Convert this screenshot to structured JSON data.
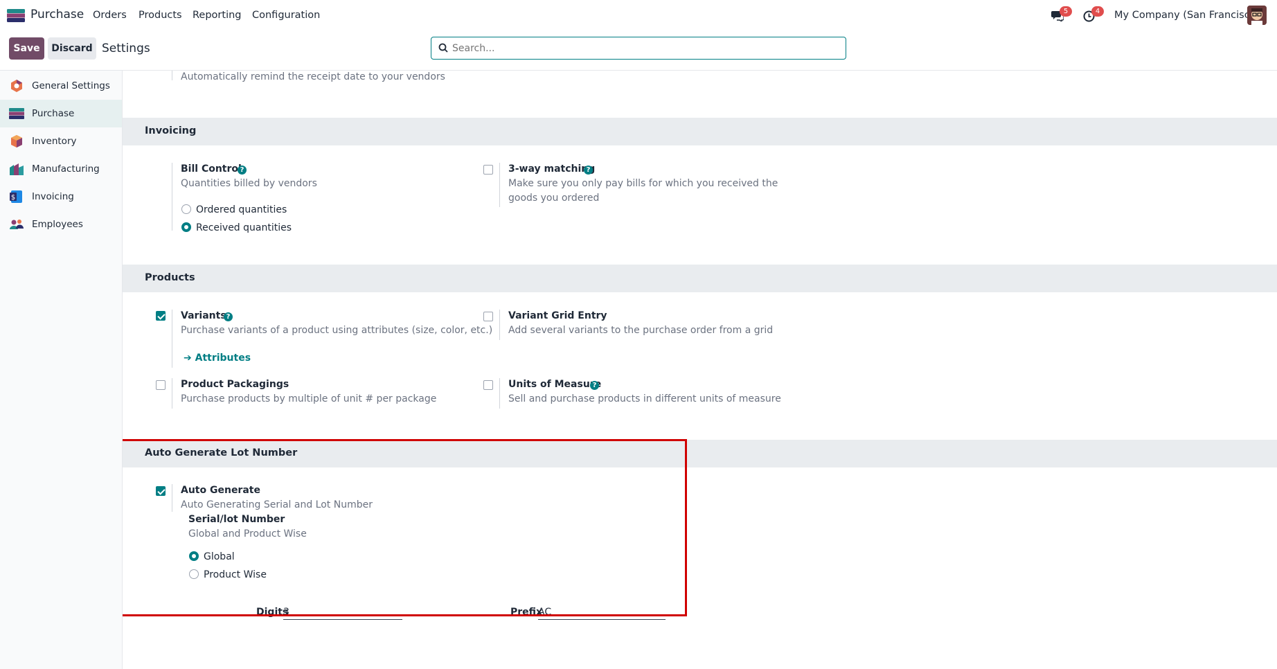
{
  "app": {
    "name": "Purchase"
  },
  "nav": {
    "menus": [
      "Orders",
      "Products",
      "Reporting",
      "Configuration"
    ],
    "messages_count": "5",
    "activities_count": "4",
    "company": "My Company (San Francisco)"
  },
  "control": {
    "save_label": "Save",
    "discard_label": "Discard",
    "breadcrumb": "Settings",
    "search_placeholder": "Search..."
  },
  "sidebar": {
    "items": [
      {
        "label": "General Settings"
      },
      {
        "label": "Purchase"
      },
      {
        "label": "Inventory"
      },
      {
        "label": "Manufacturing"
      },
      {
        "label": "Invoicing"
      },
      {
        "label": "Employees"
      }
    ]
  },
  "top_partial": {
    "desc": "Automatically remind the receipt date to your vendors"
  },
  "invoicing": {
    "title": "Invoicing",
    "bill_control": {
      "title": "Bill Control",
      "desc": "Quantities billed by vendors",
      "options": [
        "Ordered quantities",
        "Received quantities"
      ],
      "selected": "Received quantities"
    },
    "three_way": {
      "title": "3-way matching",
      "desc": "Make sure you only pay bills for which you received the goods you ordered",
      "checked": false
    }
  },
  "products": {
    "title": "Products",
    "variants": {
      "title": "Variants",
      "desc": "Purchase variants of a product using attributes (size, color, etc.)",
      "checked": true,
      "link": "Attributes"
    },
    "variant_grid": {
      "title": "Variant Grid Entry",
      "desc": "Add several variants to the purchase order from a grid",
      "checked": false
    },
    "packagings": {
      "title": "Product Packagings",
      "desc": "Purchase products by multiple of unit # per package",
      "checked": false
    },
    "uom": {
      "title": "Units of Measure",
      "desc": "Sell and purchase products in different units of measure",
      "checked": false
    }
  },
  "lot": {
    "title": "Auto Generate Lot Number",
    "auto_generate": {
      "title": "Auto Generate",
      "desc": "Auto Generating Serial and Lot Number",
      "checked": true
    },
    "serial": {
      "title": "Serial/lot Number",
      "desc": "Global and Product Wise",
      "options": [
        "Global",
        "Product Wise"
      ],
      "selected": "Global"
    },
    "digits": {
      "label": "Digits",
      "value": "3"
    },
    "prefix": {
      "label": "Prefix",
      "value": "AC"
    }
  },
  "colors": {
    "brand": "#714b67",
    "accent": "#017e84",
    "badge": "#e04d4d",
    "highlight": "#d00000"
  }
}
